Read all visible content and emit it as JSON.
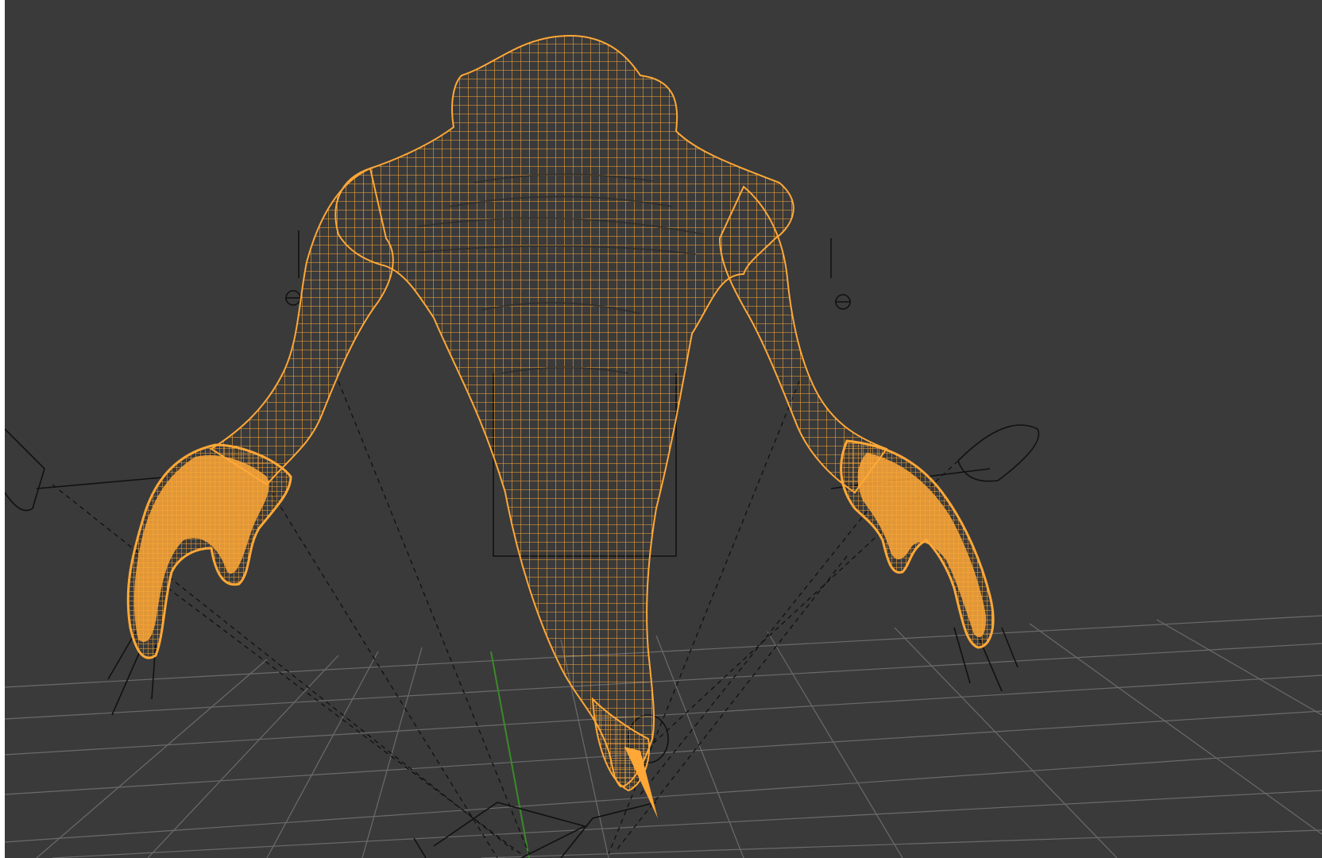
{
  "viewport": {
    "mode": "wireframe",
    "background_color": "#3a3a3a",
    "mesh_color": "#ffa837",
    "grid_color": "#6e6e6e",
    "axis_y_color": "#3a8a2a",
    "rig_color": "#111111",
    "objects": {
      "mesh": "creature-torso-mesh",
      "rig": "armature-bones",
      "ground": "floor-grid",
      "axis": "y-axis-line"
    }
  }
}
